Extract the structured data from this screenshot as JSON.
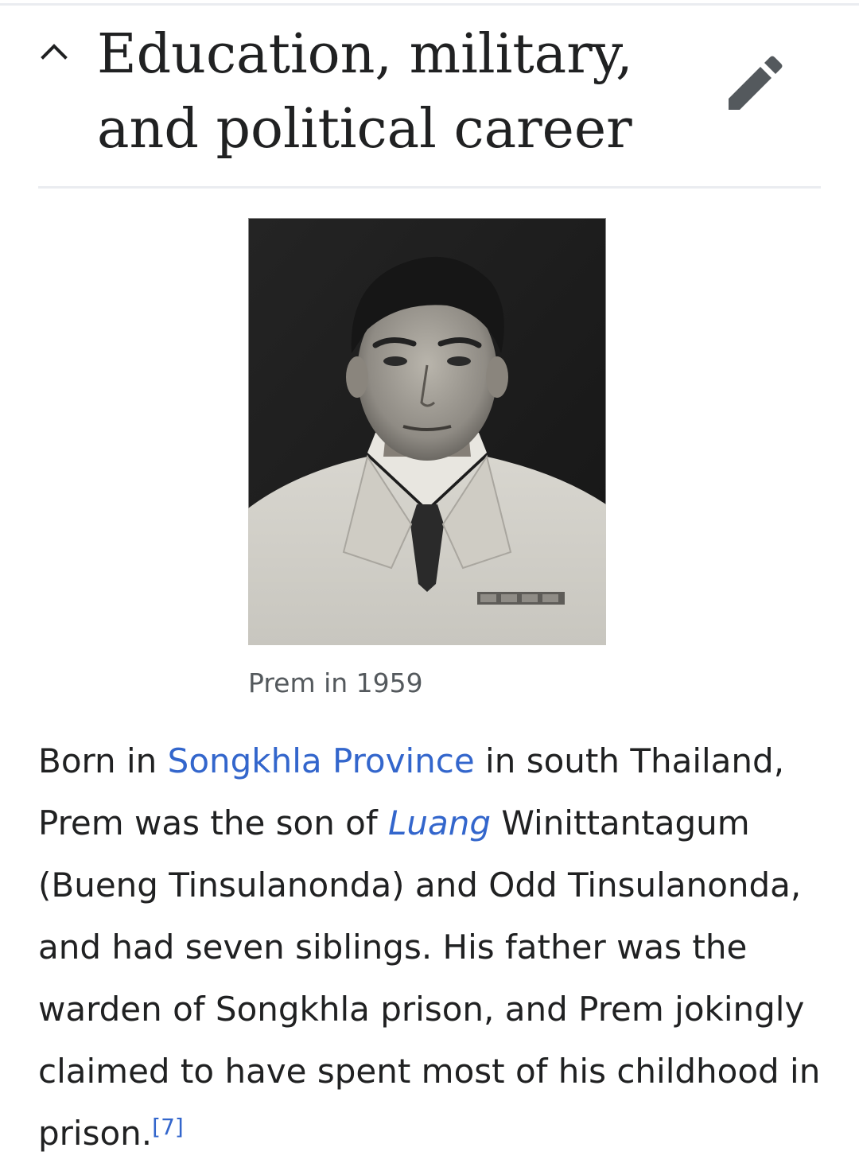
{
  "section": {
    "title": "Education, military, and political career",
    "collapse_icon": "chevron-up-icon",
    "edit_icon": "pencil-icon"
  },
  "figure": {
    "caption": "Prem in 1959"
  },
  "paragraph": {
    "t1": "Born in ",
    "link_songkhla": "Songkhla Province",
    "t2": " in south Thailand, Prem was the son of ",
    "link_luang": "Luang",
    "t3": " Winittantagum (Bueng Tinsulanonda) and Odd Tinsulanonda, and had seven siblings. His father was the warden of Songkhla prison, and Prem jokingly claimed to have spent most of his childhood in prison.",
    "ref": "[7]"
  },
  "colors": {
    "text": "#202122",
    "link": "#3366cc",
    "caption": "#54595d",
    "icon": "#54595d",
    "divider": "#eaecf0"
  }
}
